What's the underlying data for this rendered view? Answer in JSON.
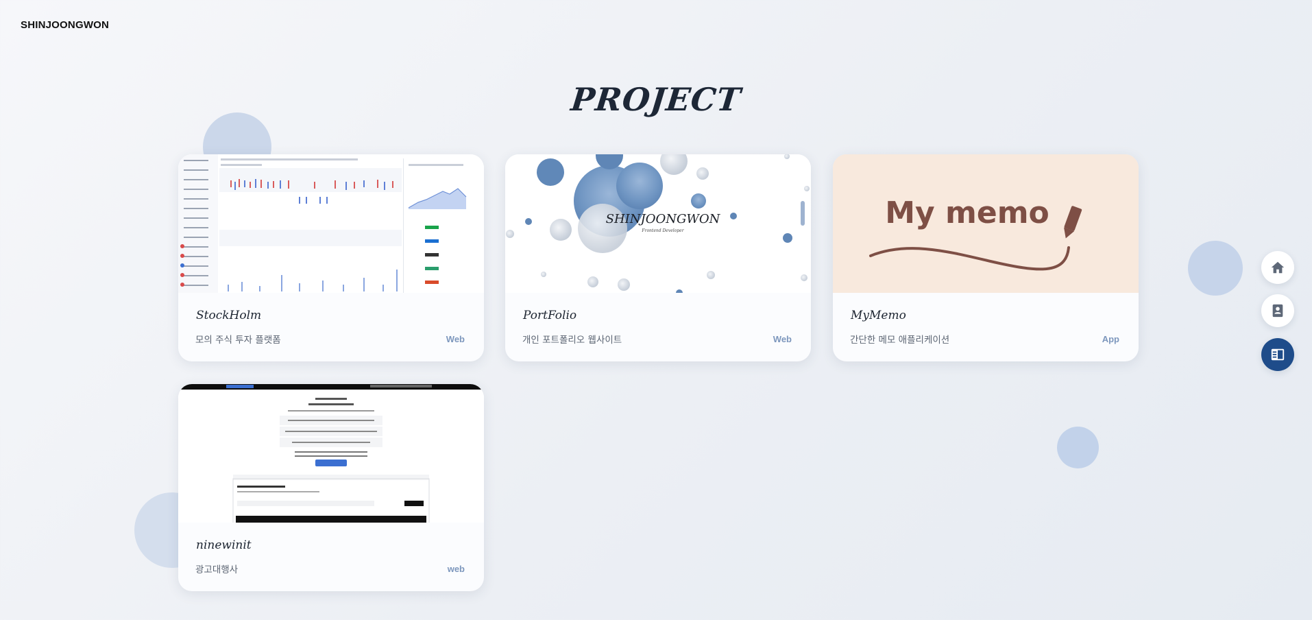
{
  "header": {
    "logo": "SHINJOONGWON"
  },
  "page": {
    "title": "PROJECT"
  },
  "projects": [
    {
      "name": "StockHolm",
      "description": "모의 주식 투자 플랫폼",
      "type": "Web"
    },
    {
      "name": "PortFolio",
      "description": "개인 포트폴리오 웹사이트",
      "type": "Web",
      "thumb_text": "SHINJOONGWON",
      "thumb_subtext": "Frontend Developer"
    },
    {
      "name": "MyMemo",
      "description": "간단한 메모 애플리케이션",
      "type": "App",
      "thumb_text": "My memo"
    },
    {
      "name": "ninewinit",
      "description": "광고대행사",
      "type": "web"
    }
  ],
  "side_nav": [
    {
      "icon": "home-icon",
      "active": false
    },
    {
      "icon": "contact-icon",
      "active": false
    },
    {
      "icon": "project-icon",
      "active": true
    }
  ],
  "colors": {
    "accent": "#1e4c8a",
    "bubble": "#c9d6ea",
    "type_label": "#7d97bd"
  }
}
